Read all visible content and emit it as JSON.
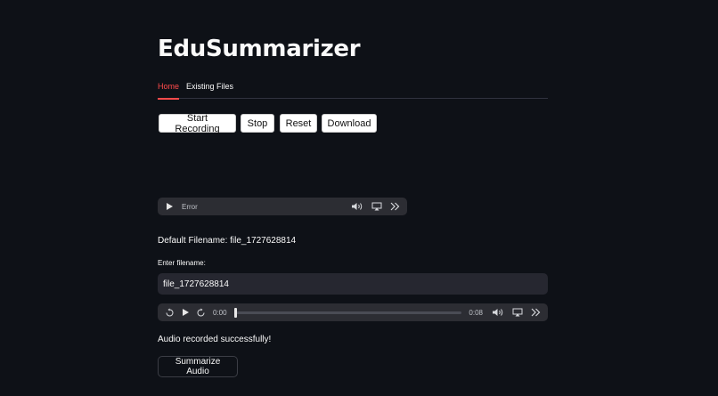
{
  "app": {
    "title": "EduSummarizer"
  },
  "tabs": [
    {
      "label": "Home",
      "active": true
    },
    {
      "label": "Existing Files",
      "active": false
    }
  ],
  "recorder": {
    "start_label": "Start Recording",
    "stop_label": "Stop",
    "reset_label": "Reset",
    "download_label": "Download"
  },
  "player_error": {
    "status_text": "Error"
  },
  "filename": {
    "default_text": "Default Filename: file_1727628814",
    "input_label": "Enter filename:",
    "input_value": "file_1727628814"
  },
  "player_audio": {
    "current_time": "0:00",
    "duration": "0:08",
    "progress": 0
  },
  "status": {
    "message": "Audio recorded successfully!"
  },
  "actions": {
    "summarize_label": "Summarize Audio"
  },
  "colors": {
    "background": "#0e1117",
    "accent": "#ff4b4b"
  }
}
